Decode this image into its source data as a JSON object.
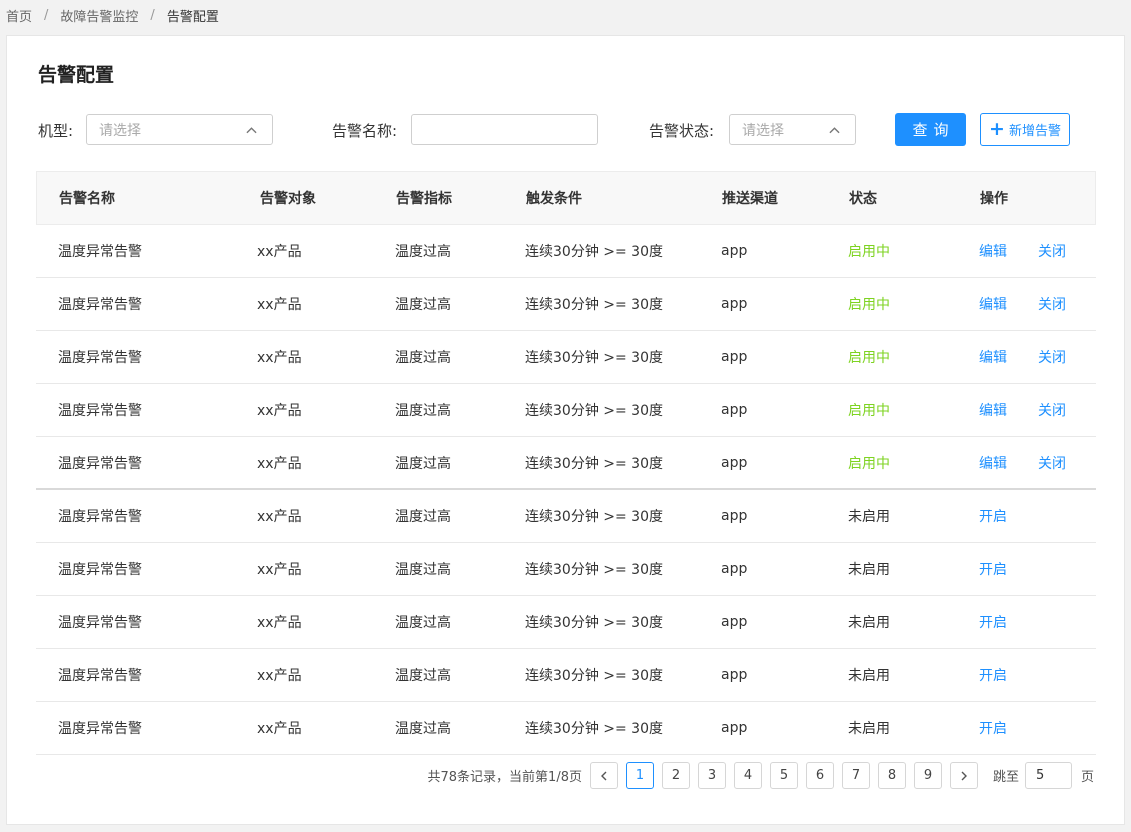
{
  "breadcrumb": {
    "items": [
      "首页",
      "故障告警监控",
      "告警配置"
    ],
    "separator": "/"
  },
  "page_title": "告警配置",
  "filters": {
    "model_label": "机型:",
    "model_placeholder": "请选择",
    "name_label": "告警名称:",
    "name_value": "",
    "status_label": "告警状态:",
    "status_placeholder": "请选择"
  },
  "buttons": {
    "query": "查询",
    "add": "新增告警"
  },
  "table": {
    "headers": [
      "告警名称",
      "告警对象",
      "告警指标",
      "触发条件",
      "推送渠道",
      "状态",
      "操作"
    ],
    "rows": [
      {
        "name": "温度异常告警",
        "target": "xx产品",
        "metric": "温度过高",
        "condition": "连续30分钟 >= 30度",
        "channel": "app",
        "status": "启用中",
        "action1": "编辑",
        "action2": "关闭"
      },
      {
        "name": "温度异常告警",
        "target": "xx产品",
        "metric": "温度过高",
        "condition": "连续30分钟 >= 30度",
        "channel": "app",
        "status": "启用中",
        "action1": "编辑",
        "action2": "关闭"
      },
      {
        "name": "温度异常告警",
        "target": "xx产品",
        "metric": "温度过高",
        "condition": "连续30分钟 >= 30度",
        "channel": "app",
        "status": "启用中",
        "action1": "编辑",
        "action2": "关闭"
      },
      {
        "name": "温度异常告警",
        "target": "xx产品",
        "metric": "温度过高",
        "condition": "连续30分钟 >= 30度",
        "channel": "app",
        "status": "启用中",
        "action1": "编辑",
        "action2": "关闭"
      },
      {
        "name": "温度异常告警",
        "target": "xx产品",
        "metric": "温度过高",
        "condition": "连续30分钟 >= 30度",
        "channel": "app",
        "status": "启用中",
        "action1": "编辑",
        "action2": "关闭"
      },
      {
        "name": "温度异常告警",
        "target": "xx产品",
        "metric": "温度过高",
        "condition": "连续30分钟 >= 30度",
        "channel": "app",
        "status": "未启用",
        "action1": "开启",
        "action2": ""
      },
      {
        "name": "温度异常告警",
        "target": "xx产品",
        "metric": "温度过高",
        "condition": "连续30分钟 >= 30度",
        "channel": "app",
        "status": "未启用",
        "action1": "开启",
        "action2": ""
      },
      {
        "name": "温度异常告警",
        "target": "xx产品",
        "metric": "温度过高",
        "condition": "连续30分钟 >= 30度",
        "channel": "app",
        "status": "未启用",
        "action1": "开启",
        "action2": ""
      },
      {
        "name": "温度异常告警",
        "target": "xx产品",
        "metric": "温度过高",
        "condition": "连续30分钟 >= 30度",
        "channel": "app",
        "status": "未启用",
        "action1": "开启",
        "action2": ""
      },
      {
        "name": "温度异常告警",
        "target": "xx产品",
        "metric": "温度过高",
        "condition": "连续30分钟 >= 30度",
        "channel": "app",
        "status": "未启用",
        "action1": "开启",
        "action2": ""
      }
    ]
  },
  "pagination": {
    "summary": "共78条记录，当前第1/8页",
    "pages": [
      "1",
      "2",
      "3",
      "4",
      "5",
      "6",
      "7",
      "8",
      "9"
    ],
    "current": "1",
    "jump_label": "跳至",
    "jump_value": "5",
    "jump_suffix": "页"
  },
  "colors": {
    "accent": "#1e90ff",
    "status_on": "#7ed321"
  }
}
